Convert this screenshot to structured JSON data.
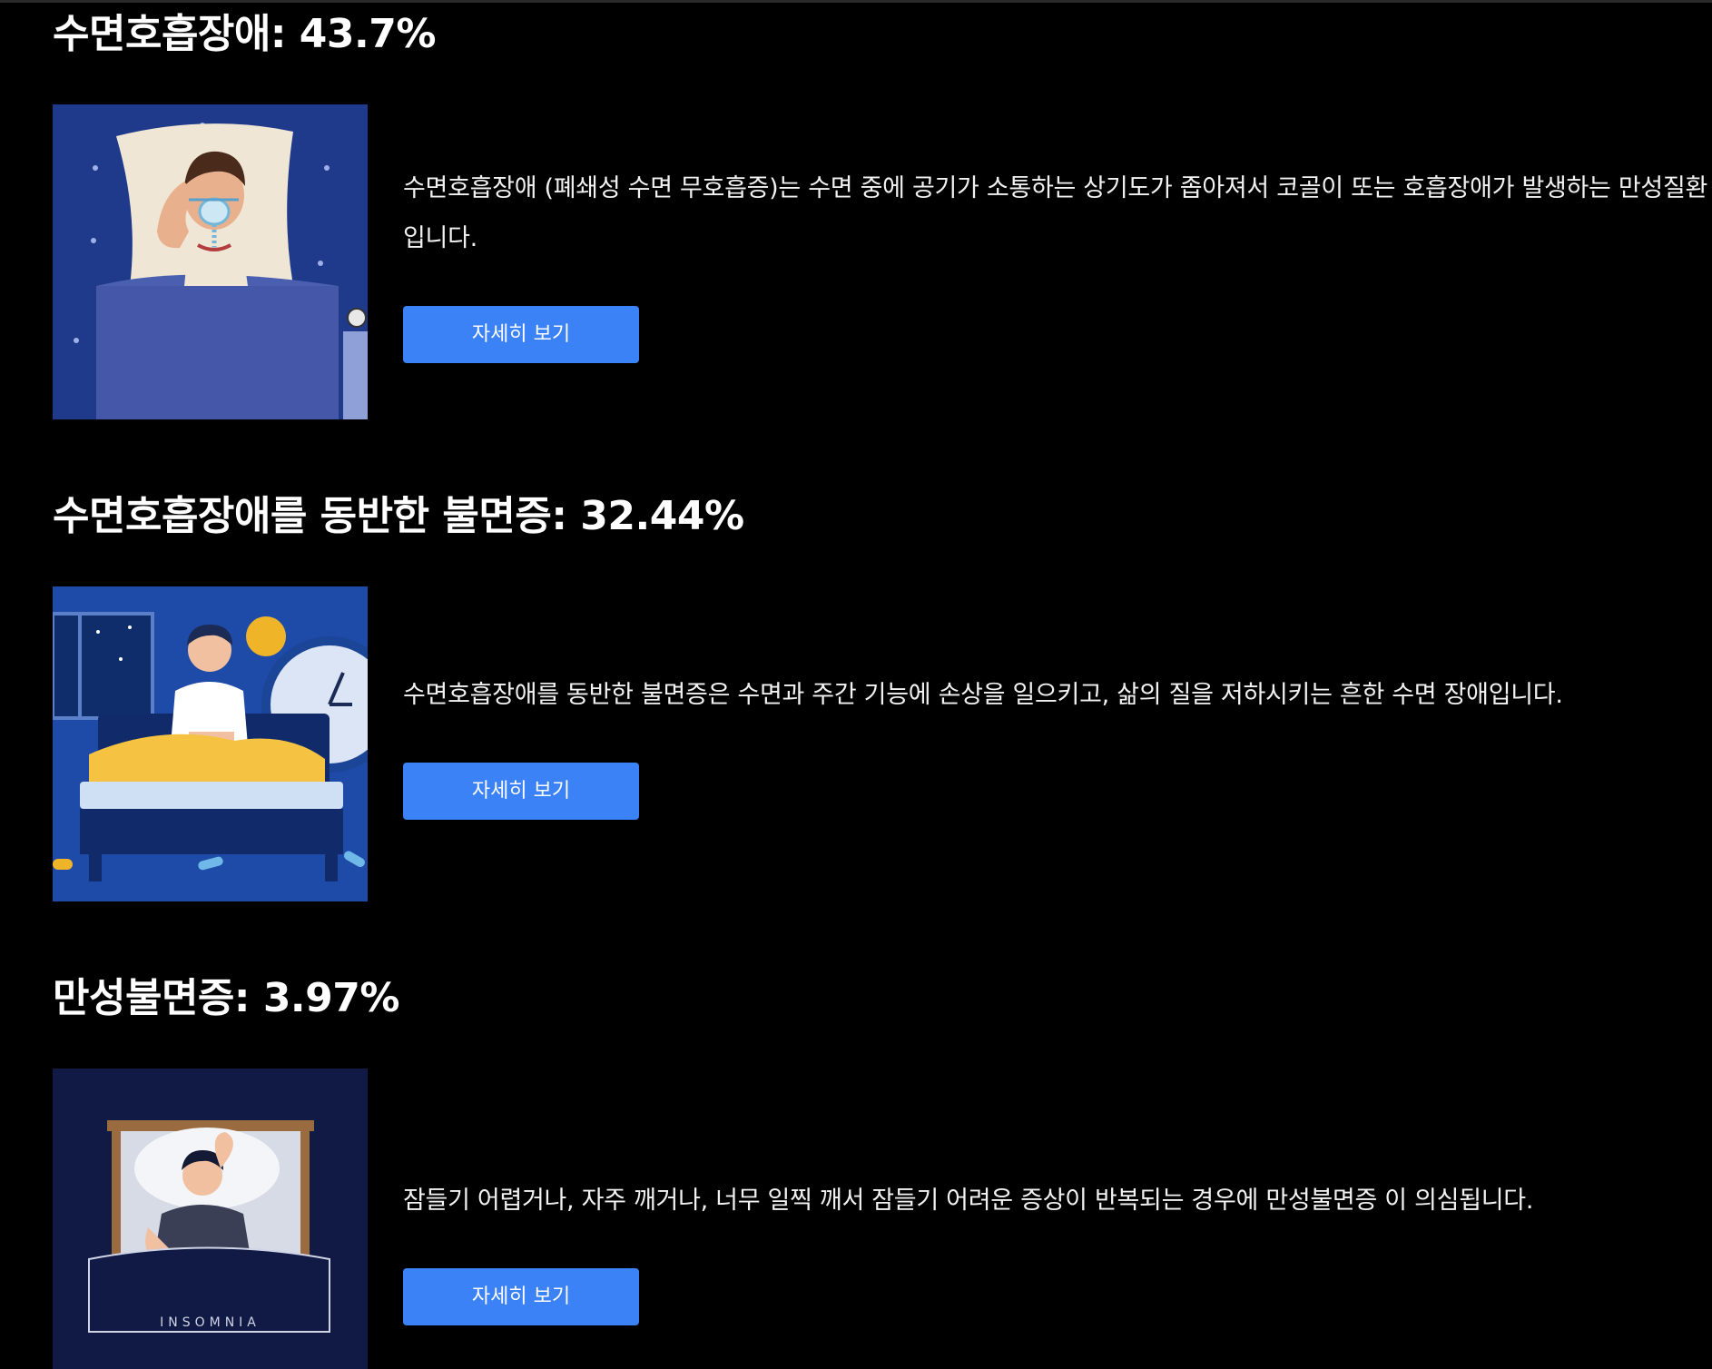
{
  "sections": [
    {
      "title": "수면호흡장애: 43.7%",
      "description": "수면호흡장애 (폐쇄성 수면 무호흡증)는 수면 중에 공기가 소통하는 상기도가 좁아져서 코골이 또는 호흡장애가 발생하는 만성질환입니다.",
      "button_label": "자세히 보기",
      "image": "sleep-apnea-cpap-illustration"
    },
    {
      "title": "수면호흡장애를 동반한 불면증: 32.44%",
      "description": "수면호흡장애를 동반한 불면증은 수면과 주간 기능에 손상을 일으키고, 삶의 질을 저하시키는 흔한 수면 장애입니다.",
      "button_label": "자세히 보기",
      "image": "insomnia-sitting-in-bed-illustration"
    },
    {
      "title": "만성불면증: 3.97%",
      "description": "잠들기 어렵거나, 자주 깨거나, 너무 일찍 깨서 잠들기 어려운 증상이 반복되는 경우에 만성불면증 이 의심됩니다.",
      "button_label": "자세히 보기",
      "image": "insomnia-lying-in-bed-illustration",
      "image_caption": "INSOMNIA"
    }
  ],
  "colors": {
    "background": "#000000",
    "button": "#3b82f6",
    "text": "#ffffff"
  }
}
